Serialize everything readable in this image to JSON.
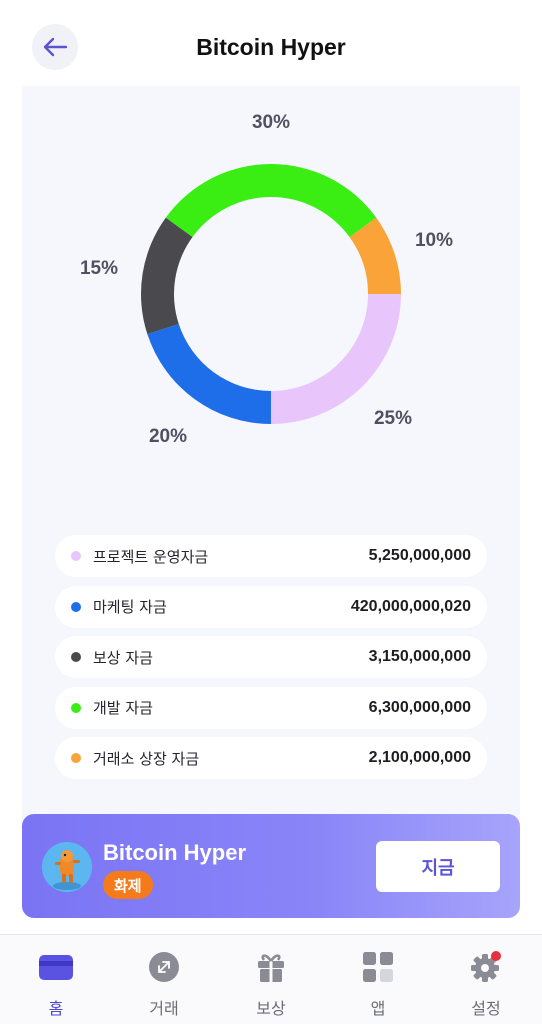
{
  "header": {
    "title": "Bitcoin Hyper"
  },
  "chart_data": {
    "type": "pie",
    "donut": true,
    "slices": [
      {
        "label": "거래소 상장 자금",
        "value": 10,
        "display": "10%",
        "color": "#f9a338"
      },
      {
        "label": "프로젝트 운영자금",
        "value": 25,
        "display": "25%",
        "color": "#e8c5fb"
      },
      {
        "label": "마케팅 자금",
        "value": 20,
        "display": "20%",
        "color": "#1e6ee9"
      },
      {
        "label": "보상 자금",
        "value": 15,
        "display": "15%",
        "color": "#4a4a4e"
      },
      {
        "label": "개발 자금",
        "value": 30,
        "display": "30%",
        "color": "#3aee14"
      }
    ]
  },
  "legend": [
    {
      "name": "프로젝트 운영자금",
      "value": "5,250,000,000",
      "color": "#e8c5fb"
    },
    {
      "name": "마케팅 자금",
      "value": "420,000,000,020",
      "color": "#1e6ee9"
    },
    {
      "name": "보상 자금",
      "value": "3,150,000,000",
      "color": "#4a4a4e"
    },
    {
      "name": "개발 자금",
      "value": "6,300,000,000",
      "color": "#3aee14"
    },
    {
      "name": "거래소 상장 자금",
      "value": "2,100,000,000",
      "color": "#f9a338"
    }
  ],
  "banner": {
    "title": "Bitcoin Hyper",
    "badge": "화제",
    "button": "지금"
  },
  "tabs": [
    {
      "label": "홈",
      "icon": "wallet-icon",
      "active": true
    },
    {
      "label": "거래",
      "icon": "swap-icon",
      "active": false
    },
    {
      "label": "보상",
      "icon": "gift-icon",
      "active": false
    },
    {
      "label": "앱",
      "icon": "apps-grid-icon",
      "active": false
    },
    {
      "label": "설정",
      "icon": "gear-icon",
      "active": false
    }
  ],
  "colors": {
    "accent": "#4d45cf",
    "notification": "#e8303c"
  }
}
